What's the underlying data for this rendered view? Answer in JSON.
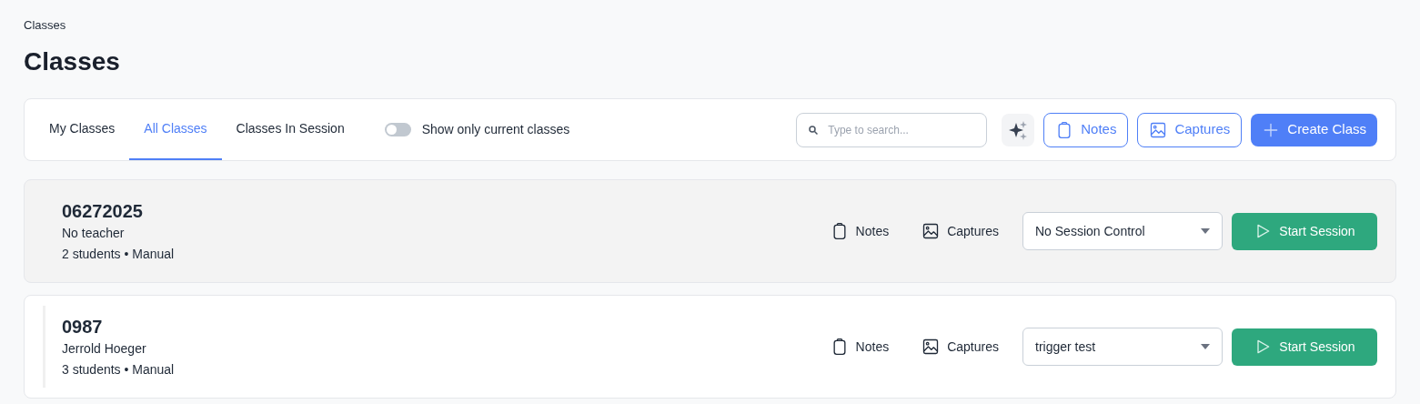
{
  "breadcrumb": "Classes",
  "title": "Classes",
  "tabs": [
    {
      "label": "My Classes",
      "selected": false
    },
    {
      "label": "All Classes",
      "selected": true
    },
    {
      "label": "Classes In Session",
      "selected": false
    }
  ],
  "toggle": {
    "label": "Show only current classes",
    "on": false
  },
  "search": {
    "placeholder": "Type to search..."
  },
  "toolbar_buttons": [
    {
      "kind": "ai"
    },
    {
      "kind": "notes",
      "label": "Notes"
    },
    {
      "kind": "captures",
      "label": "Captures"
    },
    {
      "kind": "create",
      "label": "Create Class"
    }
  ],
  "classes": [
    {
      "name": "06272025",
      "teacher": "No teacher",
      "meta": "2 students • Manual",
      "highlighted": true,
      "notes": "Notes",
      "captures": "Captures",
      "session_control": "No Session Control",
      "action": "Start Session"
    },
    {
      "name": "0987",
      "teacher": "Jerrold Hoeger",
      "meta": "3 students • Manual",
      "highlighted": false,
      "notes": "Notes",
      "captures": "Captures",
      "session_control": "trigger test",
      "action": "Start Session"
    }
  ]
}
